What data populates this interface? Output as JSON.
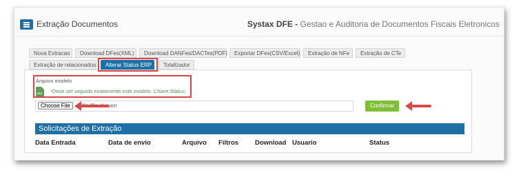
{
  "header": {
    "title": "Extração Documentos",
    "brand_bold": "Systax DFE -",
    "brand_rest": " Gestao e Auditoria de Documentos Fiscais Eletronicos"
  },
  "tabs": {
    "row1": [
      "Nova Extracao",
      "Download DFes(XML)",
      "Download DANFes/DACTes(PDF)",
      "Exportar DFes(CSV/Excel)",
      "Extração de NFe",
      "Extração de CTe"
    ],
    "row2": [
      "Extração de relacionados",
      "Alterar Status ERP",
      "Totalizador"
    ]
  },
  "form": {
    "file_label": "Arquivo modelo",
    "file_icon_text": "CSV",
    "note": "*Deve ser seguido exatamente este modelo. Chave;Status;",
    "choose_label": "Choose File",
    "file_status": "No file chosen",
    "confirm_label": "Confirmar"
  },
  "results": {
    "section_title": "Solicitações de Extração",
    "columns": [
      "Data Entrada",
      "Data de envio",
      "Arquivo",
      "Filtros",
      "Download",
      "Usuario",
      "Status"
    ]
  },
  "colors": {
    "accent_blue": "#1d6fa5",
    "highlight_red": "#d64545",
    "confirm_green": "#7fbf36"
  }
}
